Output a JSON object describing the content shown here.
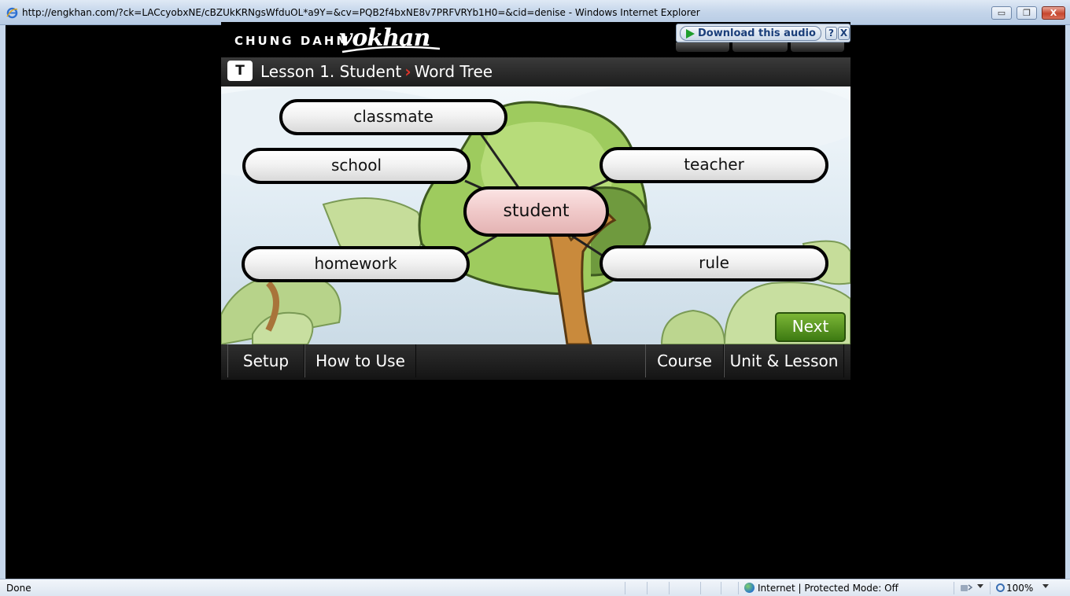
{
  "window": {
    "title": "http://engkhan.com/?ck=LACcyobxNE/cBZUkKRNgsWfduOL*a9Y=&cv=PQB2f4bxNE8v7PRFVRYb1H0=&cid=denise  - Windows Internet Explorer",
    "controls": {
      "minimize": "▭",
      "maximize": "❐",
      "close": "X"
    }
  },
  "app": {
    "brand": "CHUNG DAHM",
    "logo": "vokhan",
    "download": {
      "label": "Download this audio",
      "help": "?",
      "close": "X"
    },
    "lesson_badge": "T",
    "breadcrumb": {
      "lesson": "Lesson 1. Student",
      "separator": "›",
      "page": "Word Tree"
    },
    "words": {
      "center": "student",
      "classmate": "classmate",
      "school": "school",
      "teacher": "teacher",
      "homework": "homework",
      "rule": "rule"
    },
    "next_label": "Next",
    "nav": {
      "setup": "Setup",
      "how_to_use": "How to Use",
      "course": "Course",
      "unit_lesson": "Unit & Lesson"
    }
  },
  "status": {
    "left": "Done",
    "zone": "Internet | Protected Mode: Off",
    "zoom": "100%"
  },
  "colors": {
    "accent_next": "#4e8c1b",
    "center_word_bg": "#f0c9c9",
    "breadcrumb_separator": "#e0342a"
  }
}
